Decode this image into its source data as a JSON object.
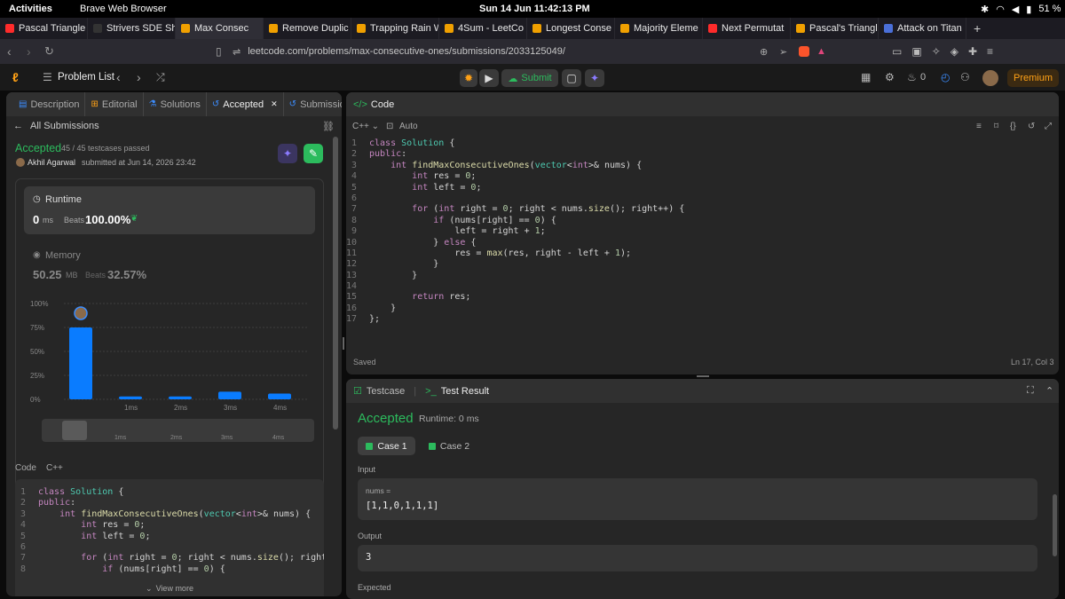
{
  "os": {
    "activities": "Activities",
    "app": "Brave Web Browser",
    "clock": "Sun 14 Jun  11:42:13 PM",
    "battery": "51 %"
  },
  "tabs": [
    {
      "label": "Pascal Triangle",
      "color": "#ff2b2b"
    },
    {
      "label": "Strivers SDE Sh",
      "color": "#333"
    },
    {
      "label": "Max Consec",
      "color": "#f0a000"
    },
    {
      "label": "Remove Duplic",
      "color": "#f0a000"
    },
    {
      "label": "Trapping Rain W",
      "color": "#f0a000"
    },
    {
      "label": "4Sum - LeetCo",
      "color": "#f0a000"
    },
    {
      "label": "Longest Conse",
      "color": "#f0a000"
    },
    {
      "label": "Majority Eleme",
      "color": "#f0a000"
    },
    {
      "label": "Next Permutat",
      "color": "#ff2b2b"
    },
    {
      "label": "Pascal's Triangl",
      "color": "#f0a000"
    },
    {
      "label": "Attack on Titan",
      "color": "#4a6fd8"
    }
  ],
  "url": "leetcode.com/problems/max-consecutive-ones/submissions/2033125049/",
  "nav": {
    "problem_list": "Problem List",
    "submit": "Submit",
    "streak": "0",
    "premium": "Premium"
  },
  "left": {
    "tabs": [
      "Description",
      "Editorial",
      "Solutions",
      "Accepted",
      "Submissions"
    ],
    "all_submissions": "All Submissions",
    "status": "Accepted",
    "testcases": "45 / 45 testcases passed",
    "author": "Akhil Agarwal",
    "submitted": "submitted at Jun 14, 2026 23:42",
    "runtime_label": "Runtime",
    "runtime_value": "0",
    "runtime_unit": "ms",
    "beats_label": "Beats",
    "runtime_beats": "100.00%",
    "memory_label": "Memory",
    "memory_value": "50.25",
    "memory_unit": "MB",
    "memory_beats": "32.57%",
    "code_label": "Code",
    "lang": "C++",
    "view_more": "View more"
  },
  "chart_data": {
    "type": "bar",
    "categories": [
      "",
      "1ms",
      "2ms",
      "3ms",
      "4ms"
    ],
    "values": [
      75,
      3,
      3,
      8,
      6
    ],
    "y_ticks": [
      "100%",
      "75%",
      "50%",
      "25%",
      "0%"
    ],
    "ylim": [
      0,
      100
    ]
  },
  "editor": {
    "title": "Code",
    "lang": "C++",
    "mode": "Auto",
    "saved": "Saved",
    "pos": "Ln 17, Col 3"
  },
  "code": [
    [
      [
        "kw",
        "class"
      ],
      [
        "vr",
        " "
      ],
      [
        "ty",
        "Solution"
      ],
      [
        "vr",
        " {"
      ]
    ],
    [
      [
        "kw",
        "public"
      ],
      [
        "vr",
        ":"
      ]
    ],
    [
      [
        "vr",
        "    "
      ],
      [
        "kw",
        "int"
      ],
      [
        "vr",
        " "
      ],
      [
        "fn",
        "findMaxConsecutiveOnes"
      ],
      [
        "vr",
        "("
      ],
      [
        "ty",
        "vector"
      ],
      [
        "vr",
        "<"
      ],
      [
        "kw",
        "int"
      ],
      [
        "vr",
        ">& nums) {"
      ]
    ],
    [
      [
        "vr",
        "        "
      ],
      [
        "kw",
        "int"
      ],
      [
        "vr",
        " res = "
      ],
      [
        "nu",
        "0"
      ],
      [
        "vr",
        ";"
      ]
    ],
    [
      [
        "vr",
        "        "
      ],
      [
        "kw",
        "int"
      ],
      [
        "vr",
        " left = "
      ],
      [
        "nu",
        "0"
      ],
      [
        "vr",
        ";"
      ]
    ],
    [
      [
        "vr",
        ""
      ]
    ],
    [
      [
        "vr",
        "        "
      ],
      [
        "kw",
        "for"
      ],
      [
        "vr",
        " ("
      ],
      [
        "kw",
        "int"
      ],
      [
        "vr",
        " right = "
      ],
      [
        "nu",
        "0"
      ],
      [
        "vr",
        "; right < nums."
      ],
      [
        "fn",
        "size"
      ],
      [
        "vr",
        "(); right++) {"
      ]
    ],
    [
      [
        "vr",
        "            "
      ],
      [
        "kw",
        "if"
      ],
      [
        "vr",
        " (nums[right] == "
      ],
      [
        "nu",
        "0"
      ],
      [
        "vr",
        ") {"
      ]
    ],
    [
      [
        "vr",
        "                left = right + "
      ],
      [
        "nu",
        "1"
      ],
      [
        "vr",
        ";"
      ]
    ],
    [
      [
        "vr",
        "            } "
      ],
      [
        "kw",
        "else"
      ],
      [
        "vr",
        " {"
      ]
    ],
    [
      [
        "vr",
        "                res = "
      ],
      [
        "fn",
        "max"
      ],
      [
        "vr",
        "(res, right - left + "
      ],
      [
        "nu",
        "1"
      ],
      [
        "vr",
        ");"
      ]
    ],
    [
      [
        "vr",
        "            }"
      ]
    ],
    [
      [
        "vr",
        "        }"
      ]
    ],
    [
      [
        "vr",
        ""
      ]
    ],
    [
      [
        "vr",
        "        "
      ],
      [
        "kw",
        "return"
      ],
      [
        "vr",
        " res;"
      ]
    ],
    [
      [
        "vr",
        "    }"
      ]
    ],
    [
      [
        "vr",
        "};"
      ]
    ]
  ],
  "testpanel": {
    "testcase": "Testcase",
    "result": "Test Result",
    "status": "Accepted",
    "runtime": "Runtime: 0 ms",
    "case1": "Case 1",
    "case2": "Case 2",
    "input": "Input",
    "var": "nums =",
    "input_val": "[1,1,0,1,1,1]",
    "output": "Output",
    "output_val": "3",
    "expected": "Expected"
  }
}
